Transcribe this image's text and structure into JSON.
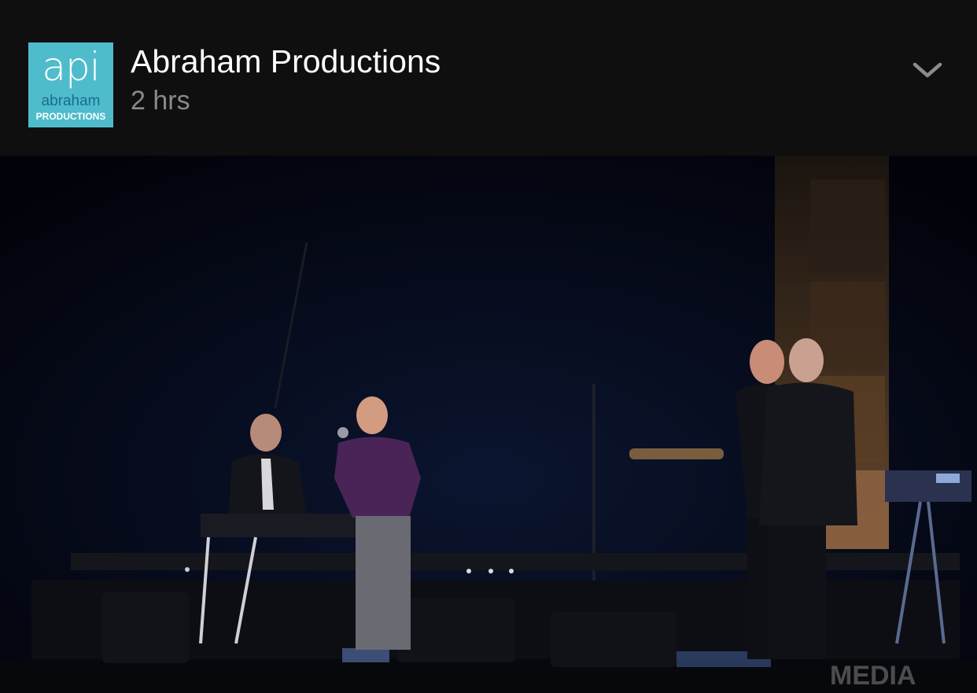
{
  "post": {
    "page_name": "Abraham Productions",
    "timestamp": "2 hrs",
    "avatar": {
      "logo_api": "api",
      "logo_abraham": "abraham",
      "logo_productions": "PRODUCTIONS",
      "bg_color": "#4fbccc"
    },
    "menu_icon": "chevron-down-icon"
  },
  "video": {
    "watermark": "MEDIA"
  }
}
